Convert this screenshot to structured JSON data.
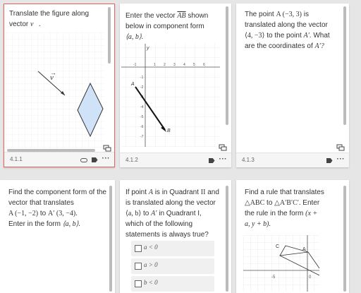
{
  "cards": [
    {
      "id": "4.1.1",
      "question": [
        "Translate the figure along",
        "vector"
      ],
      "vector_symbol": "v",
      "vector_label": "v",
      "selected": true
    },
    {
      "id": "4.1.2",
      "question": [
        "Enter the vector",
        "shown",
        "below in component form"
      ],
      "vector_name": "AB",
      "form": "⟨a, b⟩.",
      "axis": {
        "y": "y",
        "xticks": [
          "-1",
          "1",
          "2",
          "3",
          "4",
          "5",
          "6"
        ],
        "yticks": [
          "-1",
          "-2",
          "-3",
          "-4",
          "-5",
          "-6",
          "-7"
        ]
      },
      "point_a": "A",
      "point_b": "B"
    },
    {
      "id": "4.1.3",
      "question_l1_pre": "The point",
      "question_l1_math": "A (−3, 3)",
      "question_l1_post": "is",
      "question_l2": "translated along the vector",
      "question_l3_math": "⟨4, −3⟩",
      "question_l3_post": "to the point",
      "question_l3_math2": "A′",
      "question_l3_end": ". What",
      "question_l4": "are the coordinates of",
      "question_l4_math": "A′?"
    },
    {
      "q1": "Find the component form of the",
      "q2": "vector that translates",
      "q3_math": "A (−1, −2)",
      "q3_mid": "to",
      "q3_math2": "A′ (3, −4).",
      "q4": "Enter in the form",
      "q4_math": "⟨a, b⟩."
    },
    {
      "q1_pre": "If point",
      "q1_math": "A",
      "q1_mid": "is in Quadrant",
      "q1_math2": "II",
      "q1_end": "and",
      "q2": "is translated along the vector",
      "q3_math": "⟨a, b⟩",
      "q3_mid": "to",
      "q3_math2": "A′",
      "q3_end": "in Quadrant I,",
      "q4": "which of the following",
      "q5": "statements is always true?",
      "options": [
        "a < 0",
        "a > 0",
        "b < 0"
      ]
    },
    {
      "q1": "Find a rule that translates",
      "q2_math": "△ABC",
      "q2_mid": "to",
      "q2_math2": "△A′B′C′.",
      "q2_end": "Enter",
      "q3": "the rule in the form",
      "q3_math": "(x +",
      "q4_math": "a, y + b).",
      "graph": {
        "c": "C",
        "a": "A",
        "xticks": [
          "-5",
          "0"
        ]
      }
    }
  ]
}
